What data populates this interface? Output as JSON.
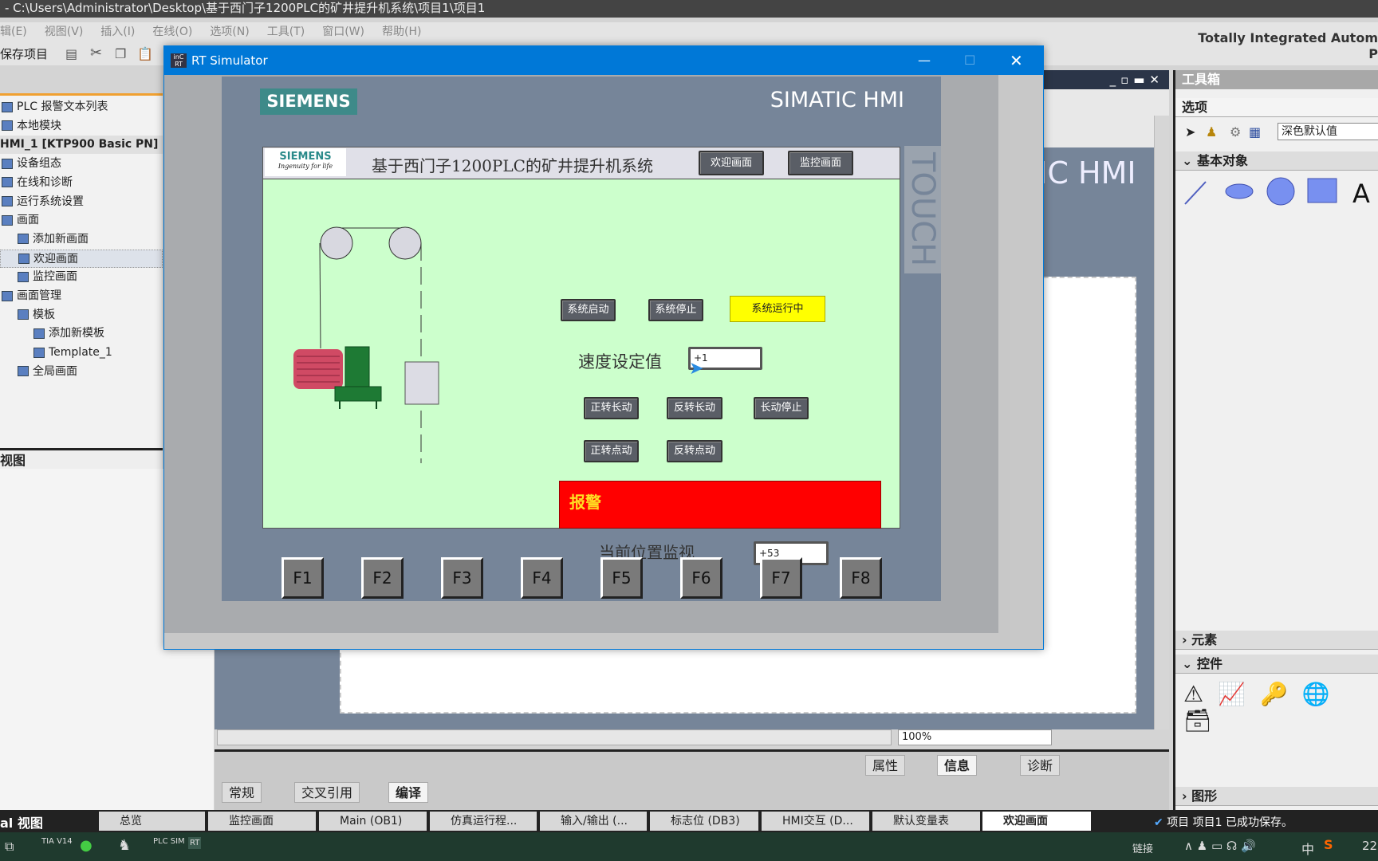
{
  "window_title": "- C:\\Users\\Administrator\\Desktop\\基于西门子1200PLC的矿井提升机系统\\项目1\\项目1",
  "menu": [
    "辑(E)",
    "视图(V)",
    "插入(I)",
    "在线(O)",
    "选项(N)",
    "工具(T)",
    "窗口(W)",
    "帮助(H)"
  ],
  "toolbar": {
    "save_label": "保存项目"
  },
  "brand": {
    "line1": "Totally Integrated Autom",
    "line2": "P"
  },
  "tree": [
    {
      "label": "PLC 报警文本列表",
      "level": 0
    },
    {
      "label": "本地模块",
      "level": 0
    },
    {
      "label": "HMI_1 [KTP900 Basic PN]",
      "level": 0,
      "header": true
    },
    {
      "label": "设备组态",
      "level": 0
    },
    {
      "label": "在线和诊断",
      "level": 0
    },
    {
      "label": "运行系统设置",
      "level": 0
    },
    {
      "label": "画面",
      "level": 0
    },
    {
      "label": "添加新画面",
      "level": 1
    },
    {
      "label": "欢迎画面",
      "level": 1,
      "selected": true
    },
    {
      "label": "监控画面",
      "level": 1
    },
    {
      "label": "画面管理",
      "level": 0
    },
    {
      "label": "模板",
      "level": 1
    },
    {
      "label": "添加新模板",
      "level": 2
    },
    {
      "label": "Template_1",
      "level": 2
    },
    {
      "label": "全局画面",
      "level": 1
    }
  ],
  "details_view": "视图",
  "editor": {
    "bg_text": "TIC HMI",
    "zoom": "100%"
  },
  "inspector": {
    "tabs_right": [
      "属性",
      "信息",
      "诊断"
    ],
    "tabs_left": [
      "常规",
      "交叉引用",
      "编译"
    ]
  },
  "toolbox": {
    "title": "工具箱",
    "options": "选项",
    "style_value": "深色默认值",
    "sections": [
      "基本对象",
      "元素",
      "控件",
      "图形"
    ],
    "basic_text_icon": "A"
  },
  "status_bar": {
    "portal_view": "al 视图",
    "tabs": [
      "总览",
      "监控画面",
      "Main (OB1)",
      "仿真运行程...",
      "输入/输出 (...",
      "标志位 (DB3)",
      "HMI交互 (D...",
      "默认变量表",
      "欢迎画面"
    ],
    "message": "项目 项目1 已成功保存。"
  },
  "taskbar": {
    "apps": [
      "TIA V14",
      "WeChat",
      "App",
      "PLC SIM",
      "RT"
    ],
    "tray_link": "链接",
    "ime": "中",
    "clock": "22"
  },
  "rt_sim": {
    "title": "RT Simulator",
    "bezel_logo": "SIEMENS",
    "bezel_model": "SIMATIC HMI",
    "touch_label": "TOUCH",
    "screen": {
      "logo": "SIEMENS",
      "logo_tag": "Ingenuity for life",
      "title": "基于西门子1200PLC的矿井提升机系统",
      "nav_buttons": [
        "欢迎画面",
        "监控画面"
      ],
      "btn_start": "系统启动",
      "btn_stop": "系统停止",
      "status_running": "系统运行中",
      "speed_label": "速度设定值",
      "speed_value": "+1",
      "btn_fwd_cont": "正转长动",
      "btn_rev_cont": "反转长动",
      "btn_cont_stop": "长动停止",
      "btn_fwd_jog": "正转点动",
      "btn_rev_jog": "反转点动",
      "alarm_text": "报警",
      "position_label": "当前位置监视",
      "position_value": "+53"
    },
    "fkeys": [
      "F1",
      "F2",
      "F3",
      "F4",
      "F5",
      "F6",
      "F7",
      "F8"
    ]
  },
  "colors": {
    "screen_bg": "#ccffcc",
    "alarm": "#ff0000",
    "running": "#ffff00",
    "title_blue": "#0078d7",
    "bezel": "#768599"
  }
}
